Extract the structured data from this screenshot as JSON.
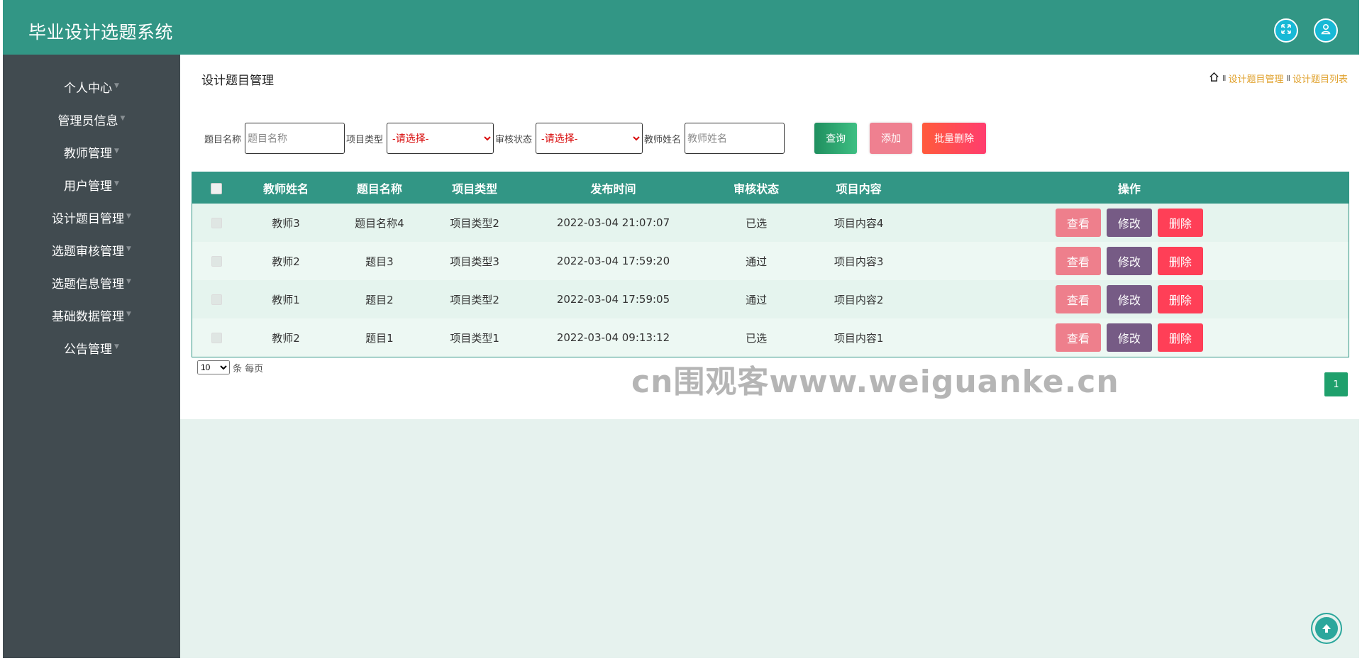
{
  "header": {
    "title": "毕业设计选题系统",
    "fullscreen_icon": "fullscreen-icon",
    "user_icon": "user-icon"
  },
  "sidebar": {
    "items": [
      {
        "label": "个人中心"
      },
      {
        "label": "管理员信息"
      },
      {
        "label": "教师管理"
      },
      {
        "label": "用户管理"
      },
      {
        "label": "设计题目管理"
      },
      {
        "label": "选题审核管理"
      },
      {
        "label": "选题信息管理"
      },
      {
        "label": "基础数据管理"
      },
      {
        "label": "公告管理"
      }
    ]
  },
  "main": {
    "page_title": "设计题目管理",
    "breadcrumb": {
      "home_icon": "home-icon",
      "sep": "II",
      "items": [
        "设计题目管理",
        "设计题目列表"
      ]
    },
    "search": {
      "title_label": "题目名称",
      "title_placeholder": "题目名称",
      "type_label": "项目类型",
      "type_selected": "-请选择-",
      "status_label": "审核状态",
      "status_selected": "-请选择-",
      "teacher_label": "教师姓名",
      "teacher_placeholder": "教师姓名",
      "query_button": "查询",
      "add_button": "添加",
      "batch_delete_button": "批量删除"
    },
    "table": {
      "columns": [
        "教师姓名",
        "题目名称",
        "项目类型",
        "发布时间",
        "审核状态",
        "项目内容",
        "操作"
      ],
      "rows": [
        {
          "teacher": "教师3",
          "title": "题目名称4",
          "type": "项目类型2",
          "time": "2022-03-04 21:07:07",
          "status": "已选",
          "content": "项目内容4"
        },
        {
          "teacher": "教师2",
          "title": "题目3",
          "type": "项目类型3",
          "time": "2022-03-04 17:59:20",
          "status": "通过",
          "content": "项目内容3"
        },
        {
          "teacher": "教师1",
          "title": "题目2",
          "type": "项目类型2",
          "time": "2022-03-04 17:59:05",
          "status": "通过",
          "content": "项目内容2"
        },
        {
          "teacher": "教师2",
          "title": "题目1",
          "type": "项目类型1",
          "time": "2022-03-04 09:13:12",
          "status": "已选",
          "content": "项目内容1"
        }
      ],
      "actions": {
        "view": "查看",
        "edit": "修改",
        "delete": "删除"
      }
    },
    "pagination": {
      "page_size": "10",
      "page_size_suffix": "条 每页",
      "current_page": "1"
    }
  },
  "watermark": "cn围观客www.weiguanke.cn",
  "colors": {
    "header": "#329685",
    "sidebar": "#414b50",
    "table_header": "#329685",
    "view_button": "#ee7f8c",
    "edit_button": "#765b85",
    "delete_button": "#ff3f57"
  }
}
